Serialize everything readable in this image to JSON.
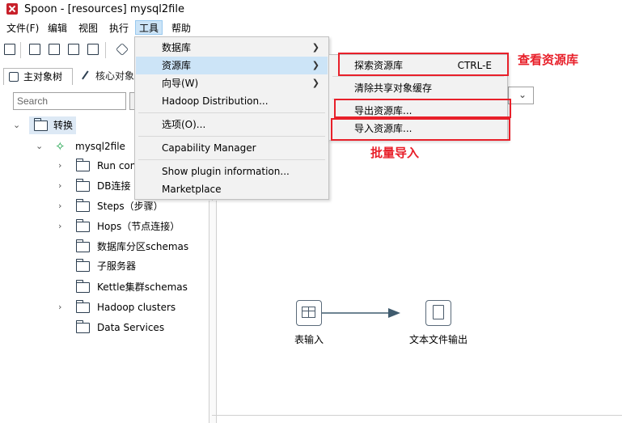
{
  "window": {
    "title": "Spoon - [resources] mysql2file"
  },
  "menubar": {
    "file": "文件(F)",
    "edit": "编辑",
    "view": "视图",
    "run": "执行",
    "tools": "工具",
    "help": "帮助"
  },
  "tabs": {
    "main": "主对象树",
    "core": "核心对象"
  },
  "search": {
    "placeholder": "Search"
  },
  "tree": {
    "root": "转换",
    "transform": "mysql2file",
    "children": [
      "Run con",
      "DB连接",
      "Steps（步骤）",
      "Hops（节点连接）",
      "数据库分区schemas",
      "子服务器",
      "Kettle集群schemas",
      "Hadoop clusters",
      "Data Services"
    ]
  },
  "tools_menu": {
    "items": [
      "数据库",
      "资源库",
      "向导(W)",
      "Hadoop Distribution...",
      "选项(O)...",
      "Capability Manager",
      "Show plugin information...",
      "Marketplace"
    ]
  },
  "repo_submenu": {
    "explore": "探索资源库",
    "explore_shortcut": "CTRL-E",
    "clear_cache": "清除共享对象缓存",
    "export": "导出资源库...",
    "import": "导入资源库..."
  },
  "annotations": {
    "view_repo": "查看资源库",
    "bulk_import": "批量导入"
  },
  "canvas": {
    "step1": "表输入",
    "step2": "文本文件输出"
  },
  "colors": {
    "accent_red": "#e8202a",
    "menu_highlight": "#cce4f7",
    "transform_green": "#1aa34a"
  }
}
